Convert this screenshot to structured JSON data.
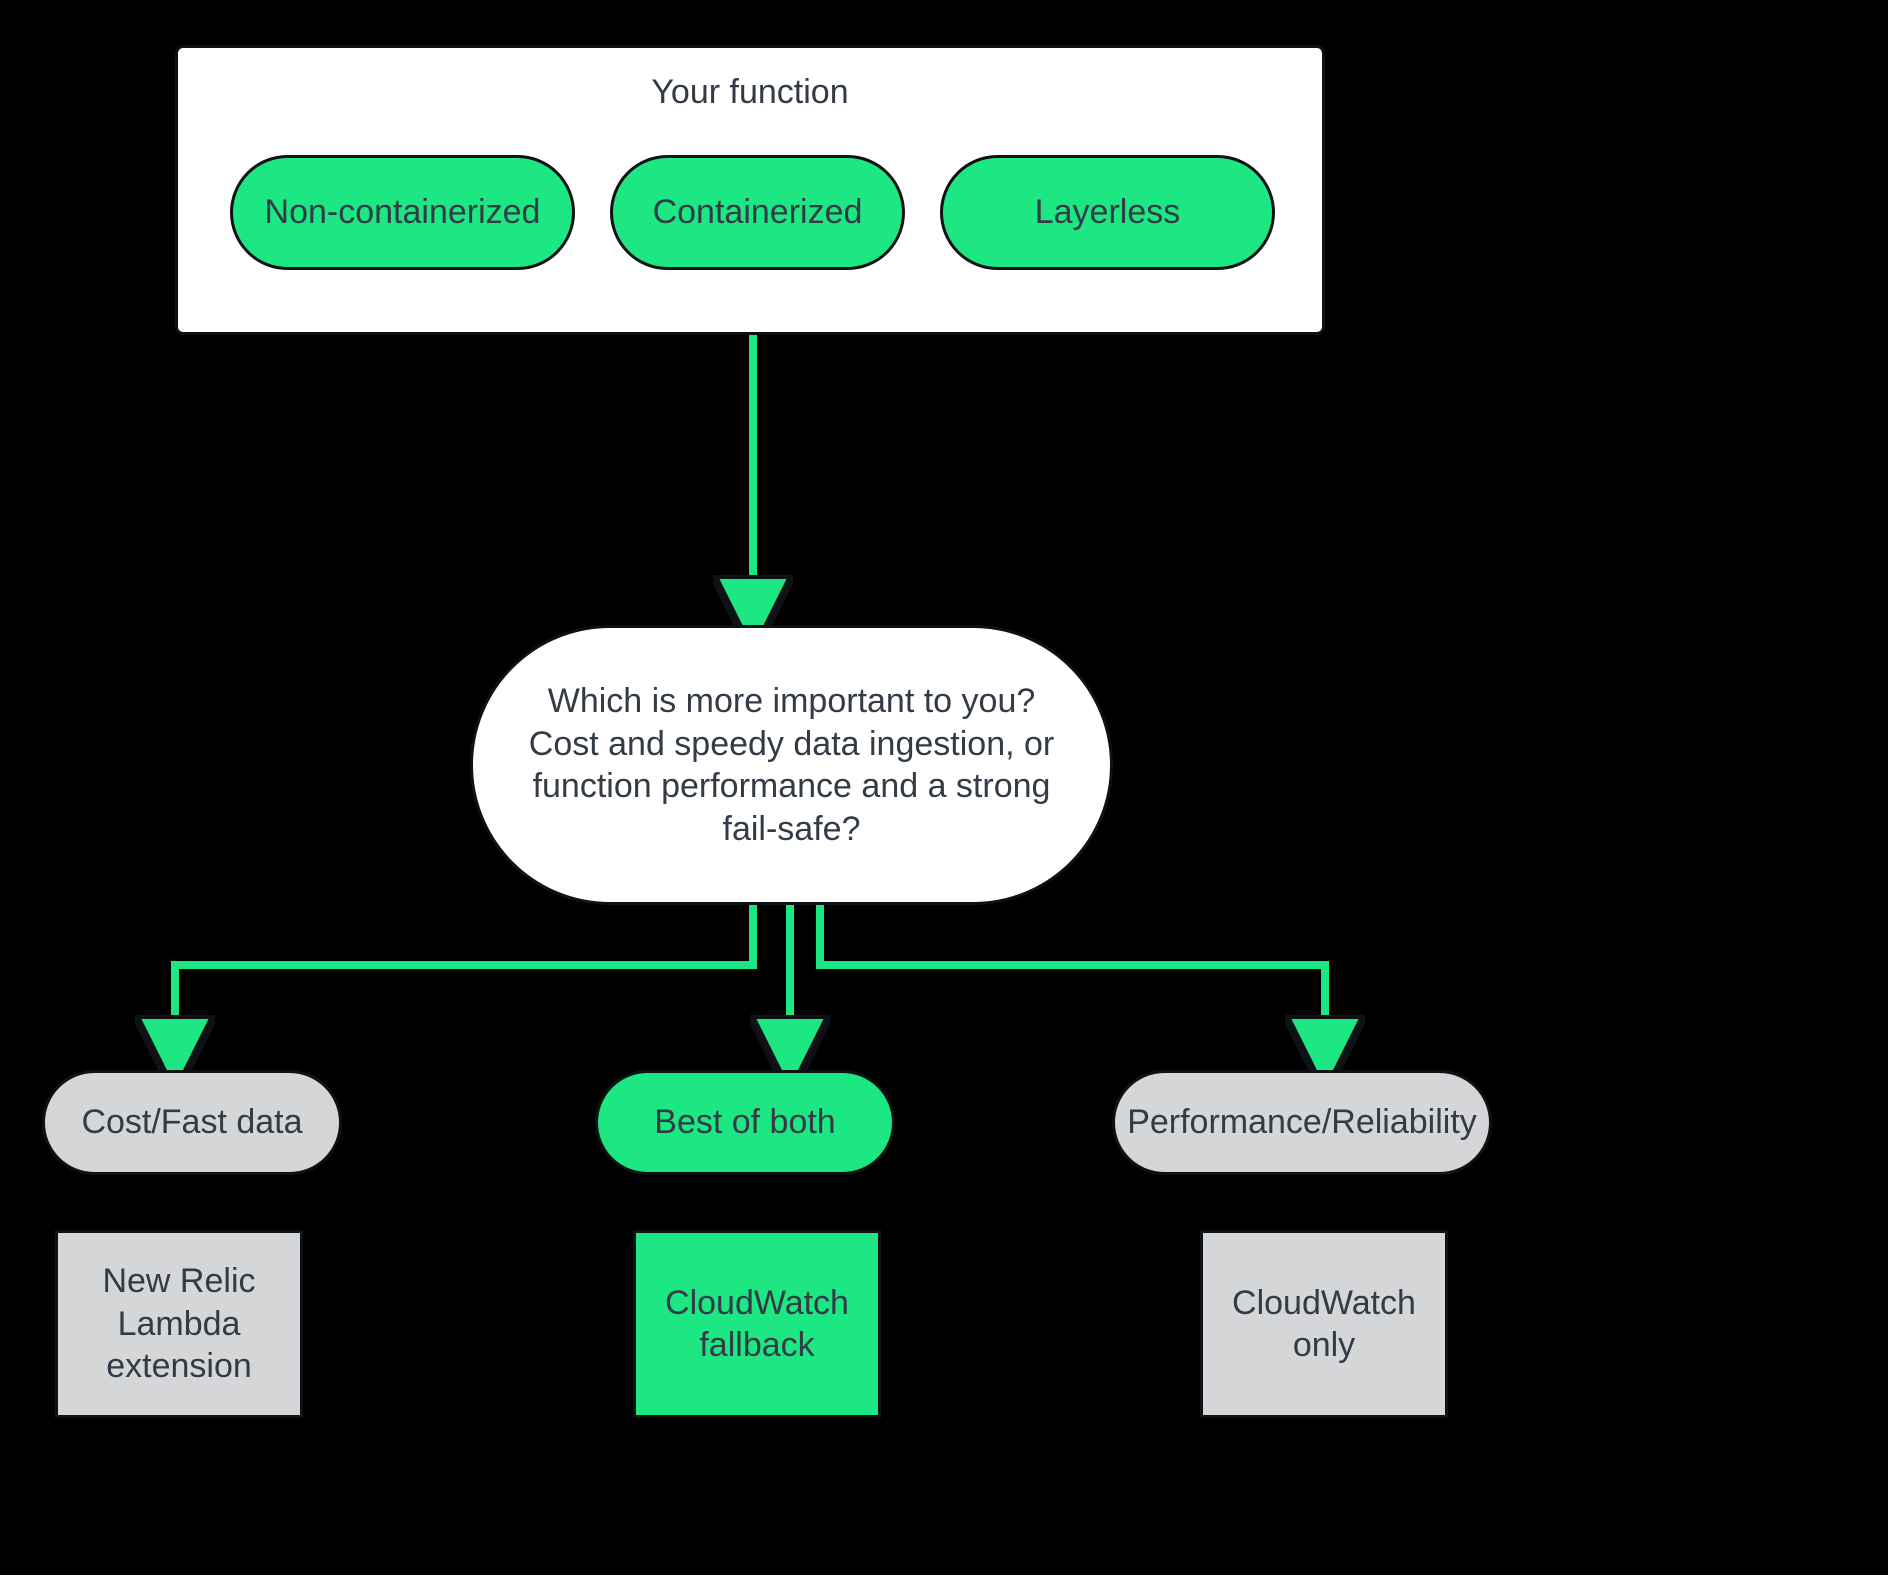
{
  "colors": {
    "green": "#1ce783",
    "grey": "#d5d6d8",
    "text": "#333b47",
    "stroke": "#0e1217"
  },
  "top_panel": {
    "title": "Your function",
    "options": [
      "Non-containerized",
      "Containerized",
      "Layerless"
    ]
  },
  "decision": {
    "text": "Which is more important to you? Cost and speedy data ingestion, or function performance and a strong fail-safe?"
  },
  "outcomes": [
    {
      "label": "Cost/Fast data",
      "result": "New Relic Lambda extension",
      "variant": "grey"
    },
    {
      "label": "Best of both",
      "result": "CloudWatch fallback",
      "variant": "green"
    },
    {
      "label": "Performance/Reliability",
      "result": "CloudWatch only",
      "variant": "grey"
    }
  ]
}
